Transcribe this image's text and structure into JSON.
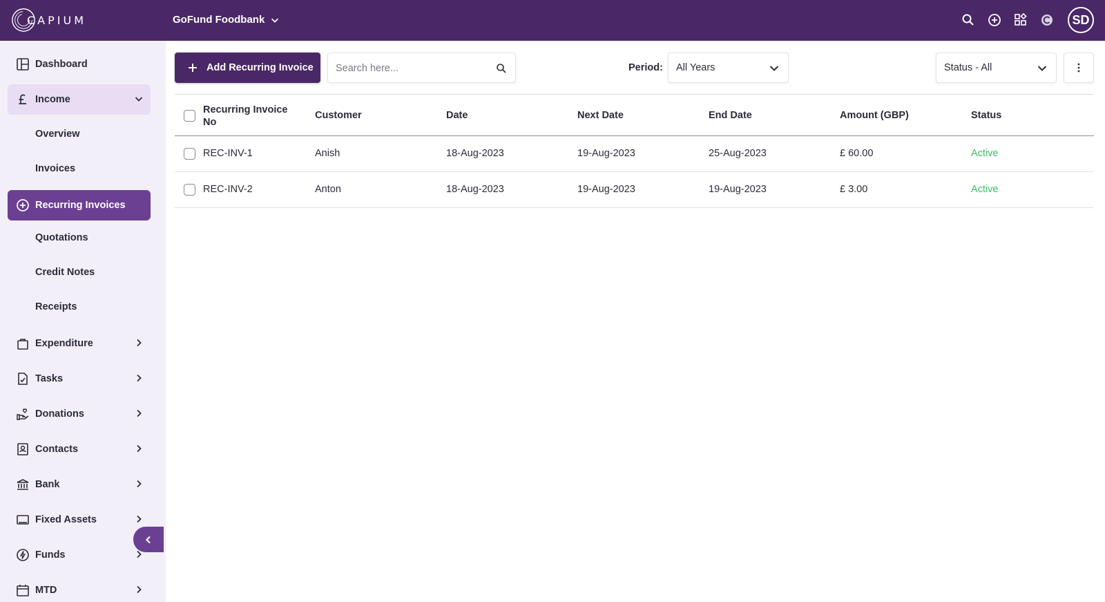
{
  "app": {
    "logo_text": "CAPIUM",
    "org_name": "GoFund Foodbank",
    "avatar_initials": "SD",
    "colors": {
      "header": "#4a2766",
      "accent": "#6b3f92",
      "sidebar_bg": "#f3eff8",
      "status_active": "#3dbb6a"
    }
  },
  "header_icons": [
    "search-icon",
    "add-circle-icon",
    "apps-grid-icon",
    "capium-c-icon"
  ],
  "sidebar": {
    "items": [
      {
        "label": "Dashboard",
        "icon": "dashboard-icon"
      },
      {
        "label": "Income",
        "icon": "pound-icon"
      },
      {
        "label": "Overview"
      },
      {
        "label": "Invoices"
      },
      {
        "label": "Recurring Invoices",
        "icon": "add-circle-icon"
      },
      {
        "label": "Quotations"
      },
      {
        "label": "Credit Notes"
      },
      {
        "label": "Receipts"
      },
      {
        "label": "Expenditure",
        "icon": "bag-icon"
      },
      {
        "label": "Tasks",
        "icon": "task-file-icon"
      },
      {
        "label": "Donations",
        "icon": "donation-hand-icon"
      },
      {
        "label": "Contacts",
        "icon": "contact-card-icon"
      },
      {
        "label": "Bank",
        "icon": "bank-icon"
      },
      {
        "label": "Fixed Assets",
        "icon": "monitor-icon"
      },
      {
        "label": "Funds",
        "icon": "bolt-circle-icon"
      },
      {
        "label": "MTD",
        "icon": "calendar-icon"
      }
    ]
  },
  "toolbar": {
    "add_button": "Add Recurring Invoice",
    "search_placeholder": "Search here...",
    "period_label": "Period:",
    "period_value": "All Years",
    "status_value": "Status - All"
  },
  "table": {
    "headers": {
      "invoice_no_line1": "Recurring Invoice",
      "invoice_no_line2": "No",
      "customer": "Customer",
      "date": "Date",
      "next_date": "Next Date",
      "end_date": "End Date",
      "amount": "Amount (GBP)",
      "status": "Status"
    },
    "rows": [
      {
        "invoice_no": "REC-INV-1",
        "customer": "Anish",
        "date": "18-Aug-2023",
        "next_date": "19-Aug-2023",
        "end_date": "25-Aug-2023",
        "amount": "£ 60.00",
        "status": "Active"
      },
      {
        "invoice_no": "REC-INV-2",
        "customer": "Anton",
        "date": "18-Aug-2023",
        "next_date": "19-Aug-2023",
        "end_date": "19-Aug-2023",
        "amount": "£ 3.00",
        "status": "Active"
      }
    ]
  }
}
